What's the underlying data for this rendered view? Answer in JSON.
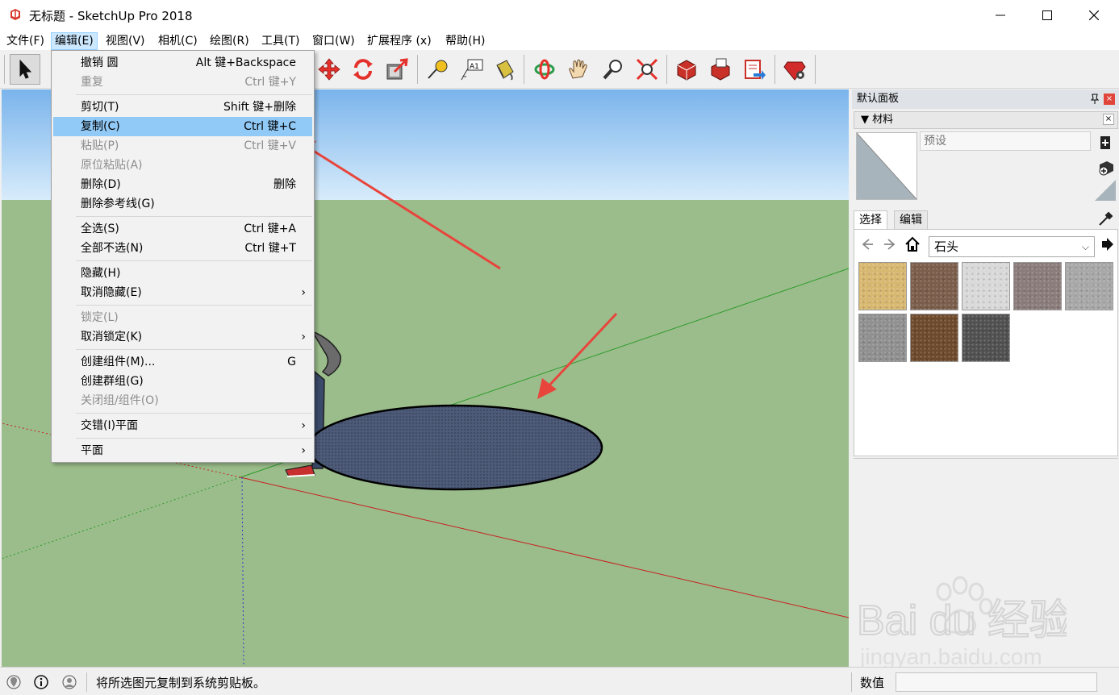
{
  "window": {
    "title": "无标题 - SketchUp Pro 2018",
    "app_icon": "sketchup-logo-icon",
    "controls": [
      "minimize-icon",
      "maximize-icon",
      "close-icon"
    ]
  },
  "menubar": {
    "items": [
      {
        "label": "文件(F)"
      },
      {
        "label": "编辑(E)"
      },
      {
        "label": "视图(V)"
      },
      {
        "label": "相机(C)"
      },
      {
        "label": "绘图(R)"
      },
      {
        "label": "工具(T)"
      },
      {
        "label": "窗口(W)"
      },
      {
        "label": "扩展程序 (x)"
      },
      {
        "label": "帮助(H)"
      }
    ]
  },
  "toolbar": {
    "icons": [
      "select-arrow-icon",
      "move-icon",
      "rotate-icon",
      "scale-icon",
      "tape-measure-icon",
      "text-label-icon",
      "paint-bucket-icon",
      "orbit-icon",
      "pan-hand-icon",
      "zoom-icon",
      "zoom-extents-icon",
      "3d-warehouse-icon",
      "share-model-icon",
      "layout-send-icon",
      "extension-warehouse-icon"
    ]
  },
  "edit_menu": {
    "items": [
      {
        "label": "撤销 圆",
        "shortcut": "Alt 键+Backspace",
        "disabled": false
      },
      {
        "label": "重复",
        "shortcut": "Ctrl 键+Y",
        "disabled": true
      },
      {
        "label": "剪切(T)",
        "shortcut": "Shift 键+删除",
        "disabled": false
      },
      {
        "label": "复制(C)",
        "shortcut": "Ctrl 键+C",
        "disabled": false,
        "highlighted": true
      },
      {
        "label": "粘贴(P)",
        "shortcut": "Ctrl 键+V",
        "disabled": true
      },
      {
        "label": "原位粘贴(A)",
        "shortcut": "",
        "disabled": true
      },
      {
        "label": "删除(D)",
        "shortcut": "删除",
        "disabled": false
      },
      {
        "label": "删除参考线(G)",
        "shortcut": "",
        "disabled": false
      },
      {
        "label": "全选(S)",
        "shortcut": "Ctrl 键+A",
        "disabled": false
      },
      {
        "label": "全部不选(N)",
        "shortcut": "Ctrl 键+T",
        "disabled": false
      },
      {
        "label": "隐藏(H)",
        "shortcut": "",
        "disabled": false
      },
      {
        "label": "取消隐藏(E)",
        "shortcut": "",
        "submenu": true
      },
      {
        "label": "锁定(L)",
        "shortcut": "",
        "disabled": true
      },
      {
        "label": "取消锁定(K)",
        "shortcut": "",
        "submenu": true
      },
      {
        "label": "创建组件(M)...",
        "shortcut": "G",
        "disabled": false
      },
      {
        "label": "创建群组(G)",
        "shortcut": "",
        "disabled": false
      },
      {
        "label": "关闭组/组件(O)",
        "shortcut": "",
        "disabled": true
      },
      {
        "label": "交错(I)平面",
        "shortcut": "",
        "submenu": true
      },
      {
        "label": "平面",
        "shortcut": "",
        "submenu": true
      }
    ],
    "submenu_glyph": "›"
  },
  "panel": {
    "title": "默认面板",
    "pin_icon": "pin-icon",
    "close_glyph": "×",
    "tray_title": "▼ 材料",
    "material_name_placeholder": "预设",
    "tabs": [
      "选择",
      "编辑"
    ],
    "library": "石头",
    "swatch_colors": [
      "#d8b870",
      "#7c5e4c",
      "#d9d9d9",
      "#8a7c7a",
      "#a8a8a8",
      "#909090",
      "#6e4a2c",
      "#505050"
    ]
  },
  "status": {
    "text": "将所选图元复制到系统剪贴板。",
    "measure_label": "数值",
    "icons": [
      "geo-location-icon",
      "info-icon",
      "user-icon"
    ]
  },
  "colors": {
    "sky_top": "#7ab4ec",
    "sky_bottom": "#d8ecfb",
    "ground": "#9bbd8b",
    "circle_fill": "#4d5a78",
    "menu_highlight": "#91c9f7",
    "annotation_arrow": "#e8453c"
  },
  "watermark": {
    "brand": "Bai du 经验",
    "url": "jingyan.baidu.com"
  }
}
